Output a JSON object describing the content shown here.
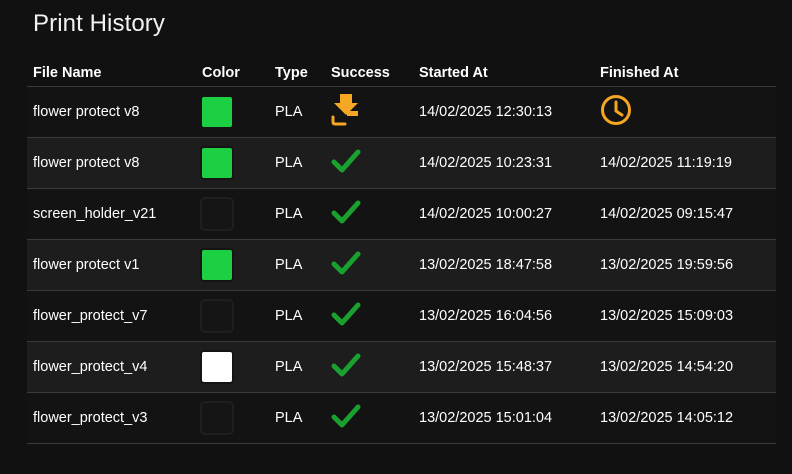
{
  "title": "Print History",
  "columns": {
    "file_name": "File Name",
    "color": "Color",
    "type": "Type",
    "success": "Success",
    "started_at": "Started At",
    "finished_at": "Finished At"
  },
  "colors": {
    "green": "#1ccf43",
    "white": "#ffffff",
    "success_check": "#1aa02f",
    "in_progress_orange": "#f5a623"
  },
  "rows": [
    {
      "file_name": "flower protect v8",
      "color": "#1ccf43",
      "type": "PLA",
      "status": "printing-icon",
      "started_at": "14/02/2025 12:30:13",
      "finished_at": "",
      "finished_icon": "clock-icon"
    },
    {
      "file_name": "flower protect v8",
      "color": "#1ccf43",
      "type": "PLA",
      "status": "check-icon",
      "started_at": "14/02/2025 10:23:31",
      "finished_at": "14/02/2025 11:19:19"
    },
    {
      "file_name": "screen_holder_v21",
      "color": "",
      "type": "PLA",
      "status": "check-icon",
      "started_at": "14/02/2025 10:00:27",
      "finished_at": "14/02/2025 09:15:47"
    },
    {
      "file_name": "flower protect v1",
      "color": "#1ccf43",
      "type": "PLA",
      "status": "check-icon",
      "started_at": "13/02/2025 18:47:58",
      "finished_at": "13/02/2025 19:59:56"
    },
    {
      "file_name": "flower_protect_v7",
      "color": "",
      "type": "PLA",
      "status": "check-icon",
      "started_at": "13/02/2025 16:04:56",
      "finished_at": "13/02/2025 15:09:03"
    },
    {
      "file_name": "flower_protect_v4",
      "color": "#ffffff",
      "type": "PLA",
      "status": "check-icon",
      "started_at": "13/02/2025 15:48:37",
      "finished_at": "13/02/2025 14:54:20"
    },
    {
      "file_name": "flower_protect_v3",
      "color": "",
      "type": "PLA",
      "status": "check-icon",
      "started_at": "13/02/2025 15:01:04",
      "finished_at": "13/02/2025 14:05:12"
    }
  ]
}
